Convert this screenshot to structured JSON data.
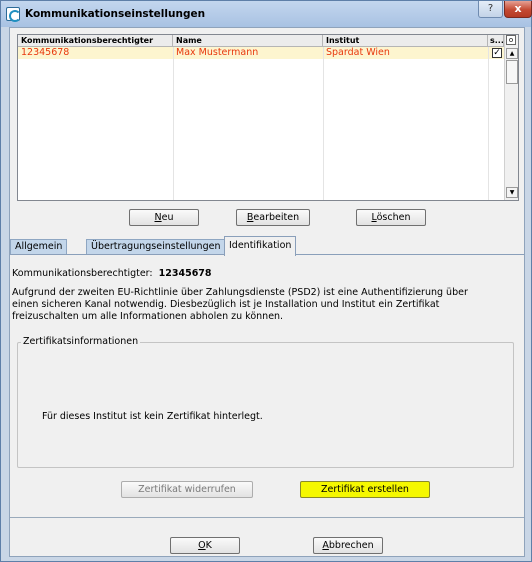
{
  "window": {
    "title": "Kommunikationseinstellungen",
    "help_glyph": "?",
    "close_glyph": "x"
  },
  "list": {
    "columns": [
      "Kommunikationsberechtigter",
      "Name",
      "Institut",
      "s..."
    ],
    "rows": [
      {
        "id": "12345678",
        "name": "Max Mustermann",
        "institut": "Spardat Wien",
        "checked": true,
        "check_glyph": "✓"
      }
    ]
  },
  "buttons": {
    "neu": {
      "underline": "N",
      "rest": "eu"
    },
    "bearbeiten": {
      "underline": "B",
      "rest": "earbeiten"
    },
    "loeschen": {
      "underline": "L",
      "rest": "öschen"
    }
  },
  "tabs": [
    {
      "label": "Allgemein",
      "active": false
    },
    {
      "label": "Übertragungseinstellungen",
      "active": false
    },
    {
      "label": "Identifikation",
      "active": true
    }
  ],
  "identifikation": {
    "label": "Kommunikationsberechtigter:",
    "value": "12345678",
    "info_lines": [
      "Aufgrund der zweiten EU-Richtlinie über Zahlungsdienste (PSD2) ist eine Authentifizierung über",
      "einen sicheren Kanal notwendig. Diesbezüglich ist je Installation und Institut ein Zertifikat",
      "freizuschalten um alle Informationen abholen zu können."
    ],
    "group_title": "Zertifikatsinformationen",
    "group_text": "Für dieses Institut ist kein Zertifikat hinterlegt.",
    "revoke_button": "Zertifikat widerrufen",
    "create_button": "Zertifikat erstellen"
  },
  "footer": {
    "ok": {
      "underline": "O",
      "rest": "K"
    },
    "cancel": {
      "underline": "A",
      "rest": "bbrechen"
    }
  },
  "colors": {
    "row_text": "#e8380d",
    "row_highlight": "#fdf5cf",
    "create_button": "#f5f800"
  }
}
